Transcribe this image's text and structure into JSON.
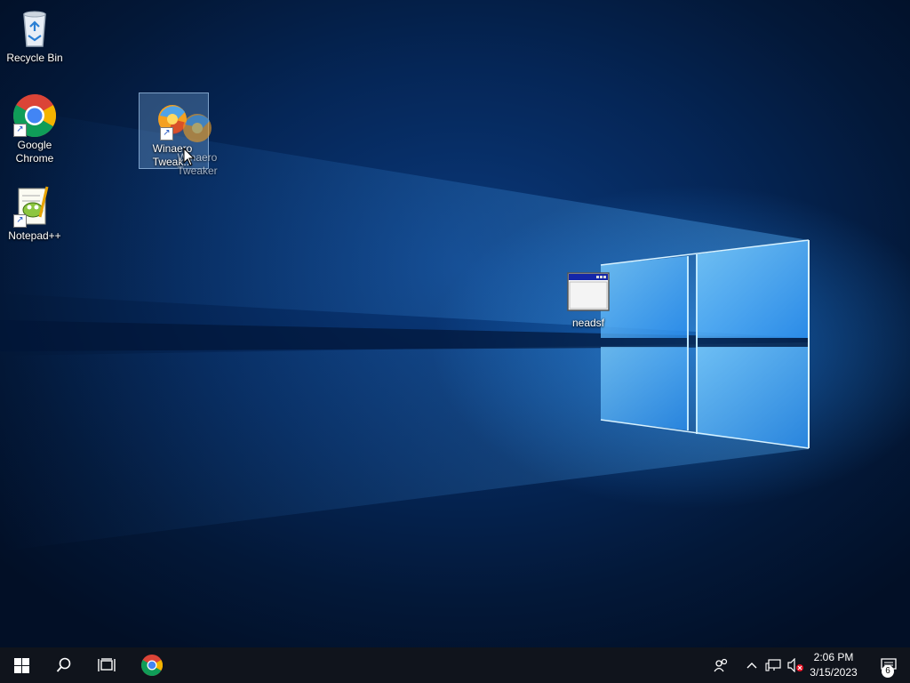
{
  "desktop": {
    "icons": {
      "recycle_bin": "Recycle Bin",
      "chrome_line1": "Google",
      "chrome_line2": "Chrome",
      "notepad": "Notepad++",
      "winaero_line1": "Winaero",
      "winaero_line2": "Tweak...",
      "winaero_ghost_line1": "Winaero",
      "winaero_ghost_line2": "Tweaker",
      "neadsf": "neadsf"
    }
  },
  "taskbar": {
    "start_icon": "windows-logo-icon",
    "search_icon": "search-icon",
    "taskview_icon": "task-view-icon",
    "chrome_icon": "chrome-icon",
    "tray": {
      "people_icon": "people-icon",
      "chevron_icon": "chevron-up-icon",
      "network_icon": "network-icon",
      "volume_icon": "volume-muted-icon",
      "time": "2:06 PM",
      "date": "3/15/2023",
      "notification_count": "6"
    }
  }
}
